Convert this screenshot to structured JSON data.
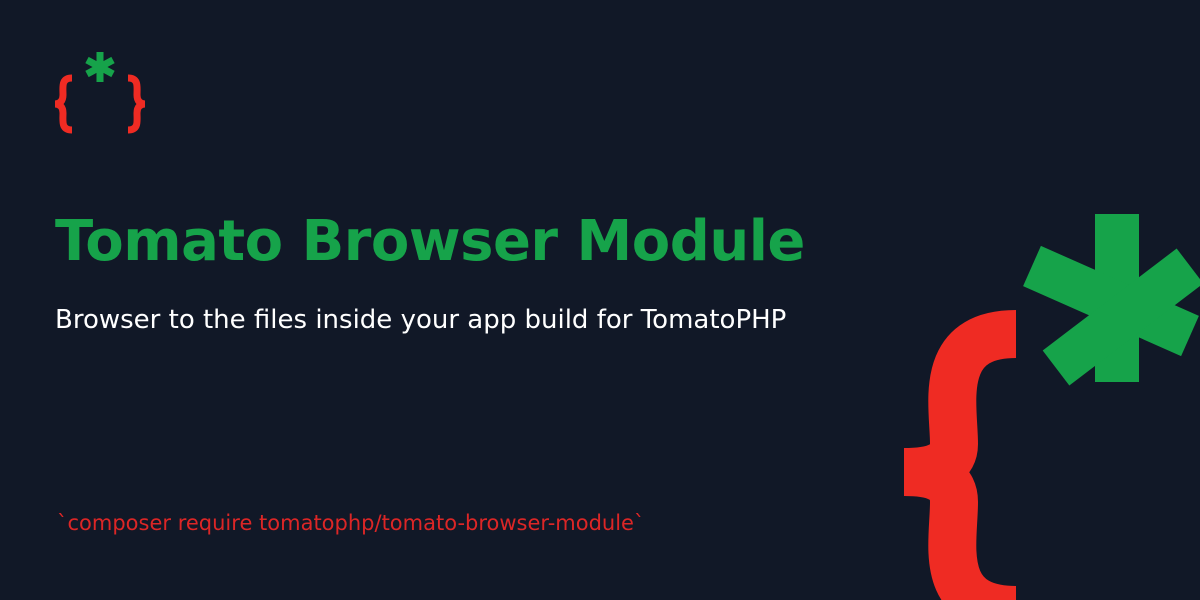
{
  "brand": {
    "logo_small_icon": "tomato-curly-brace-asterisk-logo",
    "logo_large_icon": "tomato-curly-brace-asterisk-logo",
    "colors": {
      "background": "#111827",
      "brace_red": "#ef2b23",
      "asterisk_green": "#16a34a",
      "title_green": "#16a34a",
      "subtitle_white": "#ffffff",
      "command_red": "#dc2626"
    }
  },
  "hero": {
    "title": "Tomato Browser Module",
    "subtitle": "Browser to the files inside your app build for TomatoPHP",
    "install_command": "`composer require tomatophp/tomato-browser-module`"
  }
}
